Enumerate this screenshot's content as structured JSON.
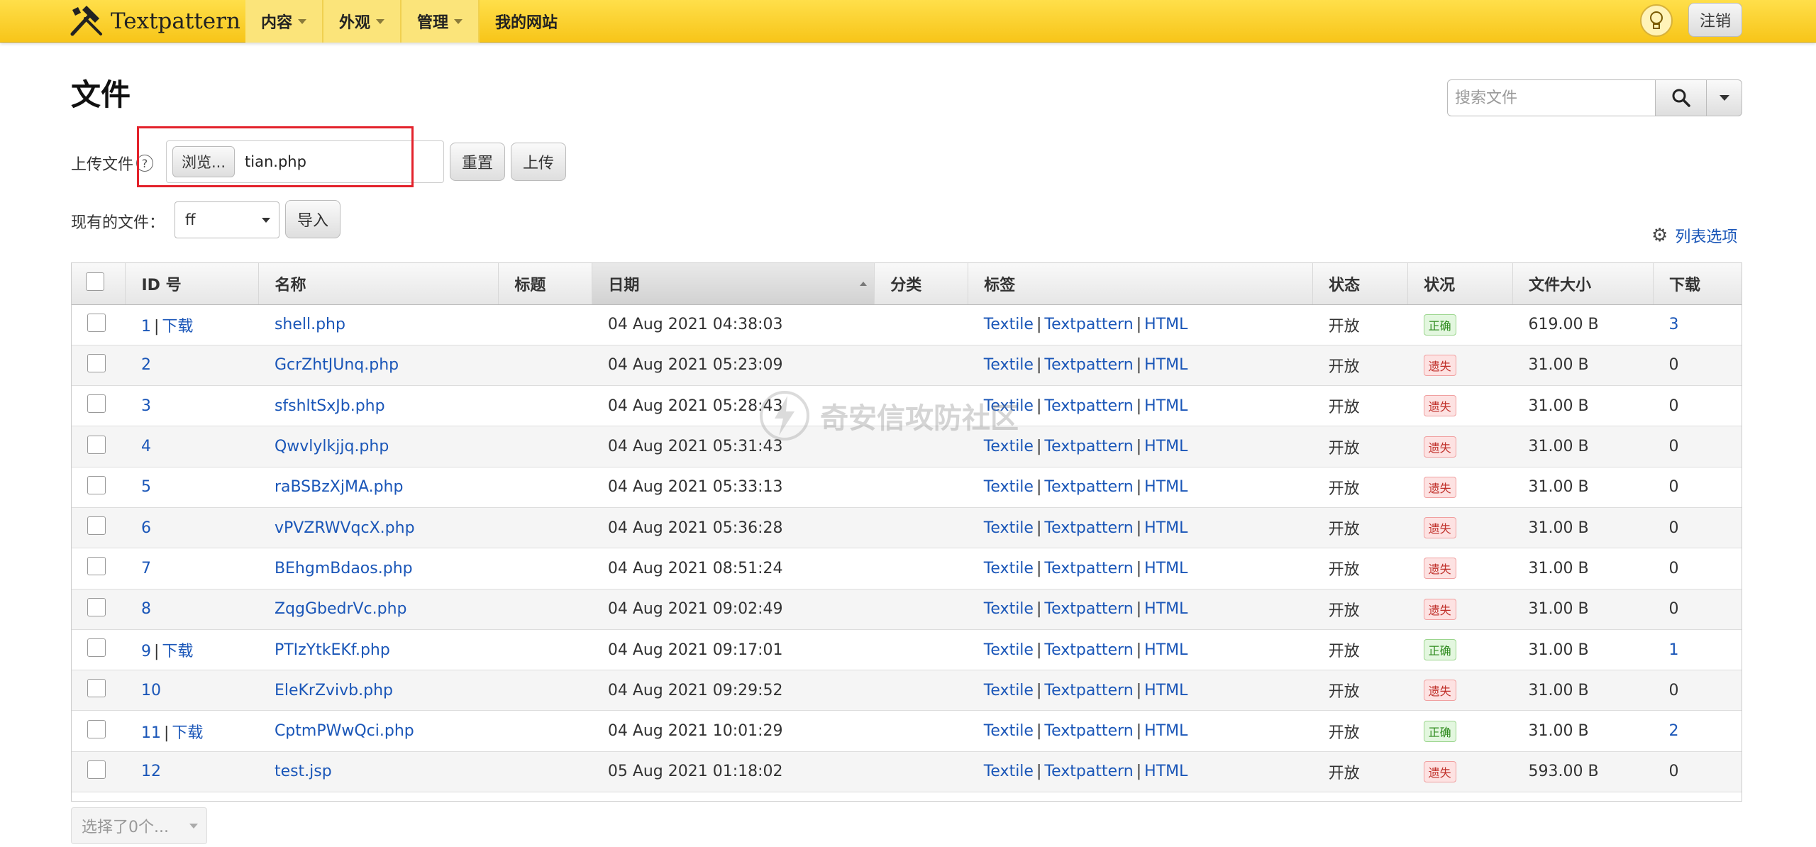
{
  "app": {
    "brand": "Textpattern"
  },
  "nav": [
    {
      "label": "内容",
      "dropdown": true,
      "highlight": true
    },
    {
      "label": "外观",
      "dropdown": true,
      "highlight": true
    },
    {
      "label": "管理",
      "dropdown": true,
      "highlight": true
    },
    {
      "label": "我的网站",
      "dropdown": false,
      "highlight": false
    }
  ],
  "header": {
    "logout_label": "注销"
  },
  "page": {
    "title": "文件"
  },
  "search": {
    "placeholder": "搜索文件"
  },
  "upload": {
    "label": "上传文件",
    "browse_label": "浏览...",
    "file_name": "tian.php",
    "reset_label": "重置",
    "upload_label": "上传"
  },
  "import": {
    "label": "现有的文件：",
    "selected": "ff",
    "import_label": "导入"
  },
  "list_options_label": "列表选项",
  "table": {
    "headers": [
      "ID 号",
      "名称",
      "标题",
      "日期",
      "分类",
      "标签",
      "状态",
      "状况",
      "文件大小",
      "下载"
    ],
    "download_label": "下载",
    "rows": [
      {
        "id": "1",
        "download": true,
        "name": "shell.php",
        "title": "",
        "date": "04 Aug 2021 04:38:03",
        "category": "",
        "tags": [
          "Textile",
          "Textpattern",
          "HTML"
        ],
        "status": "开放",
        "condition": "正确",
        "ok": true,
        "size": "619.00 B",
        "downloads": "3"
      },
      {
        "id": "2",
        "download": false,
        "name": "GcrZhtJUnq.php",
        "title": "",
        "date": "04 Aug 2021 05:23:09",
        "category": "",
        "tags": [
          "Textile",
          "Textpattern",
          "HTML"
        ],
        "status": "开放",
        "condition": "遗失",
        "ok": false,
        "size": "31.00 B",
        "downloads": "0"
      },
      {
        "id": "3",
        "download": false,
        "name": "sfshltSxJb.php",
        "title": "",
        "date": "04 Aug 2021 05:28:43",
        "category": "",
        "tags": [
          "Textile",
          "Textpattern",
          "HTML"
        ],
        "status": "开放",
        "condition": "遗失",
        "ok": false,
        "size": "31.00 B",
        "downloads": "0"
      },
      {
        "id": "4",
        "download": false,
        "name": "Qwvlylkjjq.php",
        "title": "",
        "date": "04 Aug 2021 05:31:43",
        "category": "",
        "tags": [
          "Textile",
          "Textpattern",
          "HTML"
        ],
        "status": "开放",
        "condition": "遗失",
        "ok": false,
        "size": "31.00 B",
        "downloads": "0"
      },
      {
        "id": "5",
        "download": false,
        "name": "raBSBzXjMA.php",
        "title": "",
        "date": "04 Aug 2021 05:33:13",
        "category": "",
        "tags": [
          "Textile",
          "Textpattern",
          "HTML"
        ],
        "status": "开放",
        "condition": "遗失",
        "ok": false,
        "size": "31.00 B",
        "downloads": "0"
      },
      {
        "id": "6",
        "download": false,
        "name": "vPVZRWVqcX.php",
        "title": "",
        "date": "04 Aug 2021 05:36:28",
        "category": "",
        "tags": [
          "Textile",
          "Textpattern",
          "HTML"
        ],
        "status": "开放",
        "condition": "遗失",
        "ok": false,
        "size": "31.00 B",
        "downloads": "0"
      },
      {
        "id": "7",
        "download": false,
        "name": "BEhgmBdaos.php",
        "title": "",
        "date": "04 Aug 2021 08:51:24",
        "category": "",
        "tags": [
          "Textile",
          "Textpattern",
          "HTML"
        ],
        "status": "开放",
        "condition": "遗失",
        "ok": false,
        "size": "31.00 B",
        "downloads": "0"
      },
      {
        "id": "8",
        "download": false,
        "name": "ZqgGbedrVc.php",
        "title": "",
        "date": "04 Aug 2021 09:02:49",
        "category": "",
        "tags": [
          "Textile",
          "Textpattern",
          "HTML"
        ],
        "status": "开放",
        "condition": "遗失",
        "ok": false,
        "size": "31.00 B",
        "downloads": "0"
      },
      {
        "id": "9",
        "download": true,
        "name": "PTIzYtkEKf.php",
        "title": "",
        "date": "04 Aug 2021 09:17:01",
        "category": "",
        "tags": [
          "Textile",
          "Textpattern",
          "HTML"
        ],
        "status": "开放",
        "condition": "正确",
        "ok": true,
        "size": "31.00 B",
        "downloads": "1"
      },
      {
        "id": "10",
        "download": false,
        "name": "EleKrZvivb.php",
        "title": "",
        "date": "04 Aug 2021 09:29:52",
        "category": "",
        "tags": [
          "Textile",
          "Textpattern",
          "HTML"
        ],
        "status": "开放",
        "condition": "遗失",
        "ok": false,
        "size": "31.00 B",
        "downloads": "0"
      },
      {
        "id": "11",
        "download": true,
        "name": "CptmPWwQci.php",
        "title": "",
        "date": "04 Aug 2021 10:01:29",
        "category": "",
        "tags": [
          "Textile",
          "Textpattern",
          "HTML"
        ],
        "status": "开放",
        "condition": "正确",
        "ok": true,
        "size": "31.00 B",
        "downloads": "2"
      },
      {
        "id": "12",
        "download": false,
        "name": "test.jsp",
        "title": "",
        "date": "05 Aug 2021 01:18:02",
        "category": "",
        "tags": [
          "Textile",
          "Textpattern",
          "HTML"
        ],
        "status": "开放",
        "condition": "遗失",
        "ok": false,
        "size": "593.00 B",
        "downloads": "0"
      }
    ]
  },
  "bulk": {
    "label": "选择了0个..."
  },
  "watermark": {
    "text": "奇安信攻防社区"
  },
  "colors": {
    "topbar": "#f7c519",
    "link": "#1a56b8",
    "highlight_box": "#e3222b",
    "ok": "#2d8a1c",
    "missing": "#c0302a"
  }
}
